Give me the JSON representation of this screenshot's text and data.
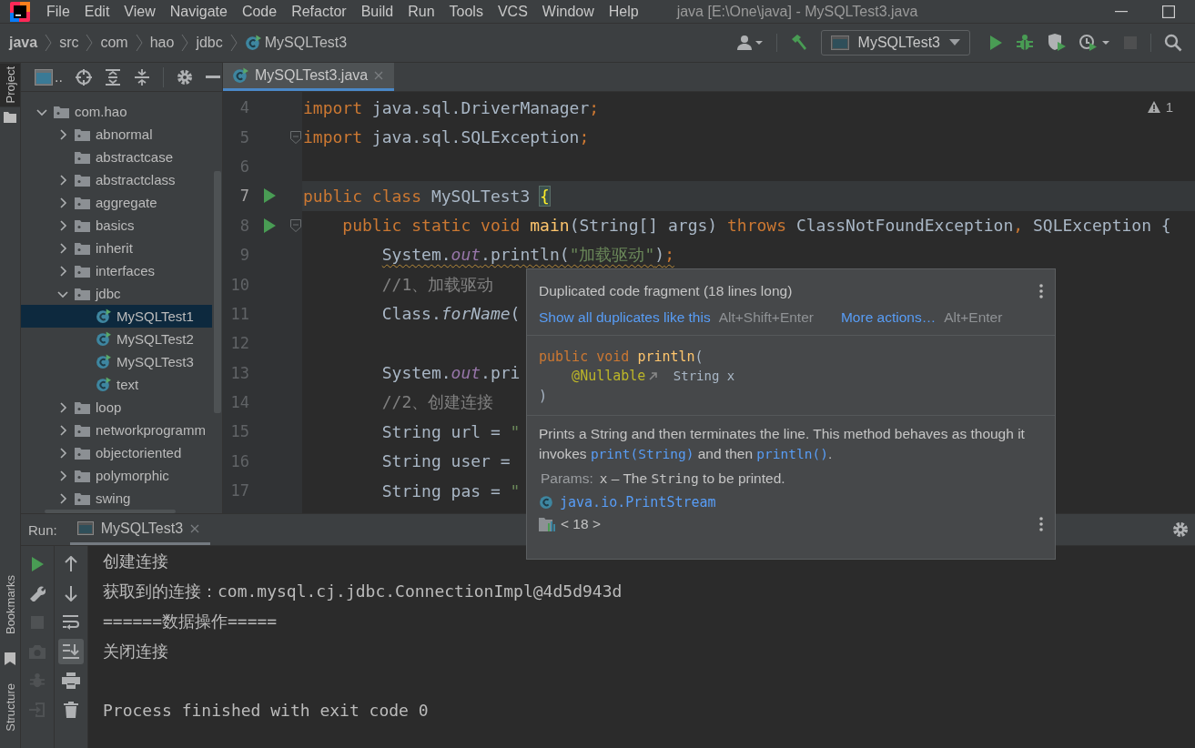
{
  "window": {
    "title": "java [E:\\One\\java] - MySQLTest3.java"
  },
  "menu": [
    "File",
    "Edit",
    "View",
    "Navigate",
    "Code",
    "Refactor",
    "Build",
    "Run",
    "Tools",
    "VCS",
    "Window",
    "Help"
  ],
  "breadcrumbs": [
    {
      "text": "java",
      "kind": "module"
    },
    {
      "text": "src",
      "kind": "folder"
    },
    {
      "text": "com",
      "kind": "folder"
    },
    {
      "text": "hao",
      "kind": "folder"
    },
    {
      "text": "jdbc",
      "kind": "folder"
    },
    {
      "text": "MySQLTest3",
      "kind": "class"
    }
  ],
  "toolbar": [
    {
      "kind": "user",
      "disabled": false
    },
    {
      "kind": "build",
      "disabled": false
    },
    {
      "kind": "config",
      "label": "MySQLTest3",
      "disabled": false
    },
    {
      "kind": "run",
      "disabled": false
    },
    {
      "kind": "debug",
      "disabled": false
    },
    {
      "kind": "coverage",
      "disabled": false
    },
    {
      "kind": "profile",
      "disabled": false
    },
    {
      "kind": "stop",
      "disabled": true
    },
    {
      "kind": "search",
      "disabled": false
    }
  ],
  "side_tabs_top": [
    {
      "label": "Project",
      "kind": "project",
      "selected": true
    }
  ],
  "side_tabs_bottom": [
    {
      "label": "Bookmarks",
      "kind": "bookmarks",
      "selected": false
    },
    {
      "label": "Structure",
      "kind": "structure",
      "selected": false
    }
  ],
  "project": {
    "view_label": "..",
    "tree": [
      {
        "label": "com.hao",
        "kind": "package",
        "expanded": true,
        "selected": false,
        "children": [
          {
            "label": "abnormal",
            "kind": "package",
            "expanded": false,
            "selected": false
          },
          {
            "label": "abstractcase",
            "kind": "package",
            "selected": false
          },
          {
            "label": "abstractclass",
            "kind": "package",
            "expanded": false,
            "selected": false
          },
          {
            "label": "aggregate",
            "kind": "package",
            "expanded": false,
            "selected": false
          },
          {
            "label": "basics",
            "kind": "package",
            "expanded": false,
            "selected": false
          },
          {
            "label": "inherit",
            "kind": "package",
            "expanded": false,
            "selected": false
          },
          {
            "label": "interfaces",
            "kind": "package",
            "expanded": false,
            "selected": false
          },
          {
            "label": "jdbc",
            "kind": "package",
            "expanded": true,
            "selected": false,
            "children": [
              {
                "label": "MySQLTest1",
                "kind": "class",
                "selected": true
              },
              {
                "label": "MySQLTest2",
                "kind": "class",
                "selected": false
              },
              {
                "label": "MySQLTest3",
                "kind": "class",
                "selected": false
              },
              {
                "label": "text",
                "kind": "class",
                "selected": false
              }
            ]
          },
          {
            "label": "loop",
            "kind": "package",
            "expanded": false,
            "selected": false
          },
          {
            "label": "networkprogramm",
            "kind": "package",
            "expanded": false,
            "selected": false
          },
          {
            "label": "objectoriented",
            "kind": "package",
            "expanded": false,
            "selected": false
          },
          {
            "label": "polymorphic",
            "kind": "package",
            "expanded": false,
            "selected": false
          },
          {
            "label": "swing",
            "kind": "package",
            "expanded": false,
            "selected": false
          }
        ]
      }
    ]
  },
  "editor": {
    "tabs": [
      {
        "label": "MySQLTest3.java",
        "selected": true
      }
    ],
    "inspection": {
      "count": "1"
    },
    "lines": [
      {
        "number": "4",
        "run": false,
        "fold": false,
        "current": false,
        "warning": false,
        "kind": "top",
        "tokens": [
          {
            "text": "import",
            "kind": "keyword"
          },
          {
            "text": " java.sql.DriverManager",
            "kind": "plain"
          },
          {
            "text": ";",
            "kind": "keyword"
          }
        ]
      },
      {
        "number": "5",
        "run": false,
        "fold": true,
        "current": false,
        "warning": false,
        "kind": "top",
        "tokens": [
          {
            "text": "import",
            "kind": "keyword"
          },
          {
            "text": " java.sql.SQLException",
            "kind": "plain"
          },
          {
            "text": ";",
            "kind": "keyword"
          }
        ]
      },
      {
        "number": "6",
        "run": false,
        "fold": false,
        "current": false
      },
      {
        "number": "7",
        "run": true,
        "fold": false,
        "current": true,
        "warning": false,
        "kind": "top",
        "tokens": [
          {
            "text": "public class ",
            "kind": "keyword"
          },
          {
            "text": "MySQLTest3 ",
            "kind": "plain"
          },
          {
            "text": "{",
            "kind": "brace"
          }
        ]
      },
      {
        "number": "8",
        "run": true,
        "fold": true,
        "current": false,
        "warning": false,
        "kind": "class",
        "tokens": [
          {
            "text": "public static void ",
            "kind": "keyword"
          },
          {
            "text": "main",
            "kind": "method"
          },
          {
            "text": "(String[] args) ",
            "kind": "plain"
          },
          {
            "text": "throws ",
            "kind": "keyword"
          },
          {
            "text": "ClassNotFoundException",
            "kind": "plain"
          },
          {
            "text": ", ",
            "kind": "keyword"
          },
          {
            "text": "SQLException {",
            "kind": "plain"
          }
        ]
      },
      {
        "number": "9",
        "run": false,
        "fold": false,
        "current": false,
        "warning": true,
        "kind": "method",
        "tokens": [
          {
            "text": "System.",
            "kind": "plain"
          },
          {
            "text": "out",
            "kind": "field"
          },
          {
            "text": ".println(",
            "kind": "plain"
          },
          {
            "text": "\"加载驱动\"",
            "kind": "string"
          },
          {
            "text": ")",
            "kind": "plain"
          },
          {
            "text": ";",
            "kind": "keyword"
          }
        ]
      },
      {
        "number": "10",
        "run": false,
        "fold": false,
        "current": false,
        "warning": false,
        "kind": "method",
        "tokens": [
          {
            "text": "//1、加载驱动",
            "kind": "comment"
          }
        ]
      },
      {
        "number": "11",
        "run": false,
        "fold": false,
        "current": false,
        "warning": false,
        "kind": "method",
        "tokens": [
          {
            "text": "Class.",
            "kind": "plain"
          },
          {
            "text": "forName",
            "kind": "static_call"
          },
          {
            "text": "(",
            "kind": "plain"
          }
        ]
      },
      {
        "number": "12",
        "run": false,
        "fold": false,
        "current": false
      },
      {
        "number": "13",
        "run": false,
        "fold": false,
        "current": false,
        "warning": false,
        "kind": "method",
        "tokens": [
          {
            "text": "System.",
            "kind": "plain"
          },
          {
            "text": "out",
            "kind": "field"
          },
          {
            "text": ".pri",
            "kind": "plain"
          }
        ]
      },
      {
        "number": "14",
        "run": false,
        "fold": false,
        "current": false,
        "warning": false,
        "kind": "method",
        "tokens": [
          {
            "text": "//2、创建连接",
            "kind": "comment"
          }
        ]
      },
      {
        "number": "15",
        "run": false,
        "fold": false,
        "current": false,
        "warning": false,
        "kind": "method",
        "tokens": [
          {
            "text": "String url = ",
            "kind": "plain"
          },
          {
            "text": "\"",
            "kind": "string"
          }
        ]
      },
      {
        "number": "16",
        "run": false,
        "fold": false,
        "current": false,
        "warning": false,
        "kind": "method",
        "tokens": [
          {
            "text": "String user =",
            "kind": "plain"
          }
        ]
      },
      {
        "number": "17",
        "run": false,
        "fold": false,
        "current": false,
        "warning": false,
        "kind": "method",
        "tokens": [
          {
            "text": "String pas = ",
            "kind": "plain"
          },
          {
            "text": "\"",
            "kind": "string"
          }
        ]
      }
    ]
  },
  "popup": {
    "title": "Duplicated code fragment (18 lines long)",
    "actions": [
      {
        "label": "Show all duplicates like this",
        "shortcut": "Alt+Shift+Enter"
      },
      {
        "label": "More actions…",
        "shortcut": "Alt+Enter"
      }
    ],
    "signature": [
      {
        "kind": "top",
        "tokens": [
          {
            "text": "public void ",
            "kind": "keyword"
          },
          {
            "text": "println",
            "kind": "method"
          },
          {
            "text": "(",
            "kind": "plain"
          }
        ]
      },
      {
        "kind": "param",
        "tokens": [
          {
            "text": "@Nullable",
            "kind": "annotation"
          },
          {
            "text": " String x",
            "kind": "small"
          }
        ]
      },
      {
        "kind": "top",
        "tokens": [
          {
            "text": ")",
            "kind": "plain"
          }
        ]
      }
    ],
    "description": [
      {
        "text": "Prints a String and then terminates the line. This method behaves as though it invokes ",
        "kind": "text"
      },
      {
        "text": "print(String)",
        "kind": "link"
      },
      {
        "text": " and then ",
        "kind": "text"
      },
      {
        "text": "println()",
        "kind": "link"
      },
      {
        "text": ".",
        "kind": "text"
      }
    ],
    "params_label": "Params:",
    "params": [
      {
        "text": "x",
        "kind": "code"
      },
      {
        "text": " – The ",
        "kind": "text"
      },
      {
        "text": "String",
        "kind": "code"
      },
      {
        "text": " to be printed.",
        "kind": "text"
      }
    ],
    "class_link": "java.io.PrintStream",
    "library": "< 18 >"
  },
  "run": {
    "label": "Run:",
    "tabs": [
      {
        "label": "MySQLTest3",
        "selected": true
      }
    ],
    "left_tools": [
      {
        "kind": "rerun",
        "disabled": false
      },
      {
        "kind": "settings",
        "disabled": false
      },
      {
        "kind": "stop",
        "disabled": true
      },
      {
        "kind": "snapshot",
        "disabled": true
      },
      {
        "kind": "debug",
        "disabled": true
      },
      {
        "kind": "exit",
        "disabled": true
      }
    ],
    "right_tools": [
      {
        "kind": "up",
        "selected": false
      },
      {
        "kind": "down",
        "selected": false
      },
      {
        "kind": "wrap",
        "selected": false
      },
      {
        "kind": "scroll_end",
        "selected": true
      },
      {
        "kind": "print",
        "selected": false
      },
      {
        "kind": "clear",
        "selected": false
      }
    ],
    "output": [
      {
        "text": "创建连接",
        "kind": "output"
      },
      {
        "text": "获取到的连接：com.mysql.cj.jdbc.ConnectionImpl@4d5d943d",
        "kind": "output"
      },
      {
        "text": "======数据操作=====",
        "kind": "output"
      },
      {
        "text": "关闭连接",
        "kind": "output"
      },
      {
        "text": "Process finished with exit code 0",
        "kind": "exit"
      }
    ]
  }
}
